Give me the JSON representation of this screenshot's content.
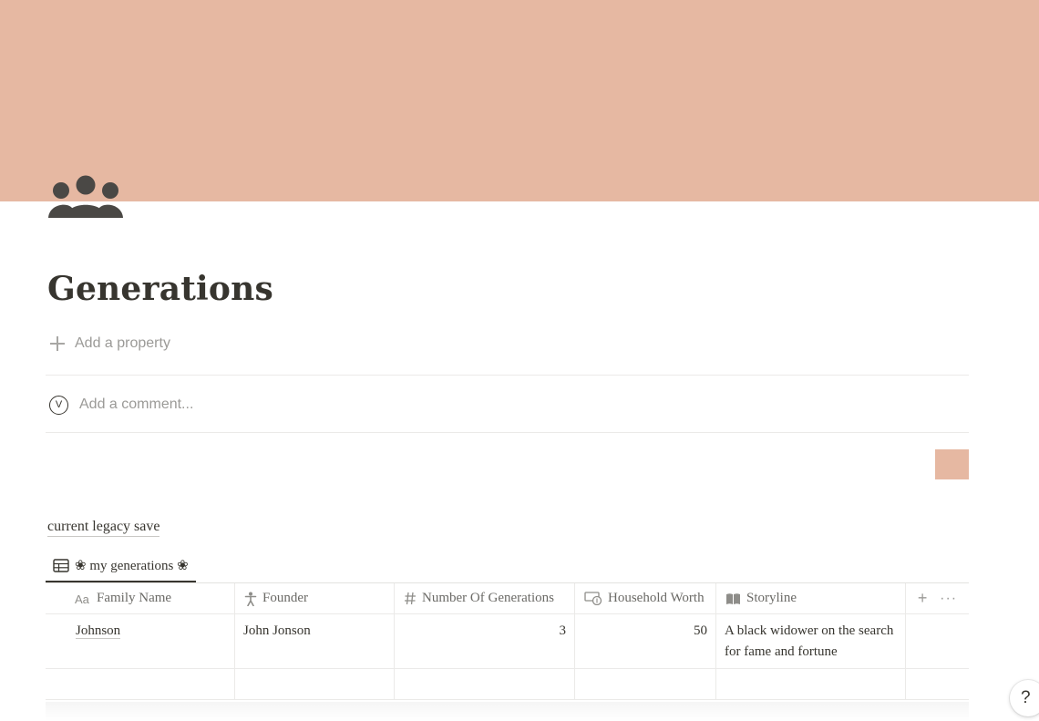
{
  "cover": {
    "color": "#e6b8a2"
  },
  "page": {
    "icon": "people-group-icon",
    "title": "Generations",
    "add_property_label": "Add a property",
    "comment": {
      "avatar_letter": "V",
      "placeholder": "Add a comment..."
    }
  },
  "database": {
    "title": "current legacy save",
    "view_tab_label": "❀ my generations ❀",
    "columns": [
      {
        "label": "Family Name",
        "icon": "title-aa-icon"
      },
      {
        "label": "Founder",
        "icon": "person-icon"
      },
      {
        "label": "Number Of Generations",
        "icon": "hash-icon"
      },
      {
        "label": "Household Worth",
        "icon": "money-icon"
      },
      {
        "label": "Storyline",
        "icon": "book-icon"
      }
    ],
    "rows": [
      {
        "family_name": "Johnson",
        "founder": "John Jonson",
        "number_of_generations": "3",
        "household_worth": "50",
        "storyline": "A black widower on the search for fame and fortune"
      }
    ],
    "add_column_symbol": "+",
    "more_symbol": "···"
  },
  "help": {
    "label": "?"
  },
  "colors": {
    "accent_swatch": "#e6b8a2",
    "text": "#37352f",
    "muted": "#9b9a97"
  }
}
